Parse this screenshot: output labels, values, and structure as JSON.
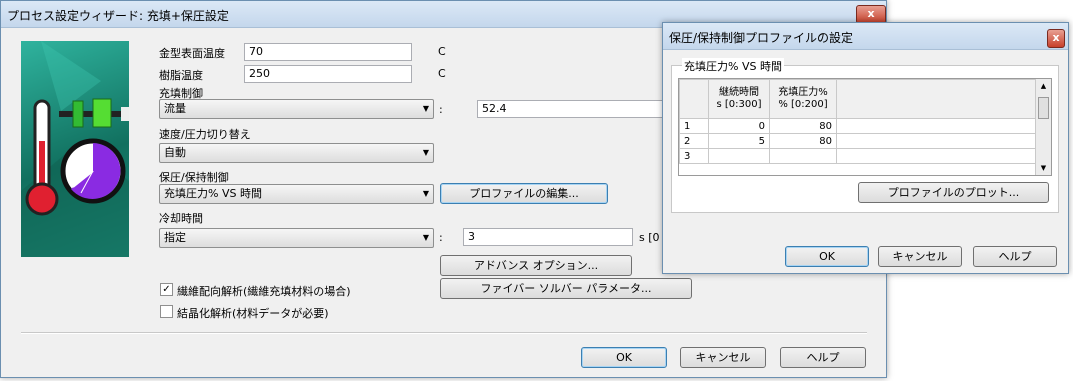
{
  "main_dialog": {
    "title": "プロセス設定ウィザード: 充填+保圧設定",
    "close_glyph": "x",
    "mold_temp": {
      "label": "金型表面温度",
      "value": "70",
      "unit": "C"
    },
    "melt_temp": {
      "label": "樹脂温度",
      "value": "250",
      "unit": "C"
    },
    "fill_control": {
      "label": "充填制御",
      "selected": "流量",
      "colon": ":",
      "value": "52.4"
    },
    "vp_switch": {
      "label": "速度/圧力切り替え",
      "selected": "自動"
    },
    "pack_control": {
      "label": "保圧/保持制御",
      "selected": "充填圧力% VS 時間",
      "edit_button": "プロファイルの編集..."
    },
    "cooling_time": {
      "label": "冷却時間",
      "selected": "指定",
      "colon": ":",
      "value": "3",
      "unit": "s [0"
    },
    "advanced_button": "アドバンス オプション...",
    "fiber_button": "ファイバー ソルバー パラメータ...",
    "fiber_check": {
      "label": "繊維配向解析(繊維充填材料の場合)",
      "checked": true
    },
    "crystal_check": {
      "label": "結晶化解析(材料データが必要)",
      "checked": false
    },
    "ok": "OK",
    "cancel": "キャンセル",
    "help": "ヘルプ"
  },
  "profile_dialog": {
    "title": "保圧/保持制御プロファイルの設定",
    "close_glyph": "x",
    "group_label": "充填圧力% VS 時間",
    "col1_line1": "継続時間",
    "col1_line2": "s [0:300]",
    "col2_line1": "充填圧力%",
    "col2_line2": "% [0:200]",
    "rows": [
      {
        "num": "1",
        "time": "0",
        "pressure": "80"
      },
      {
        "num": "2",
        "time": "5",
        "pressure": "80"
      },
      {
        "num": "3",
        "time": "",
        "pressure": ""
      }
    ],
    "plot_button": "プロファイルのプロット...",
    "ok": "OK",
    "cancel": "キャンセル",
    "help": "ヘルプ"
  },
  "icons": [
    "thermometer-icon",
    "clock-icon",
    "valve-icon",
    "combo-arrow-icon"
  ],
  "colors": {
    "title_bg": "#c4d7ec",
    "close_red": "#c7402b",
    "image_bg": "#1d9a86",
    "thermo_red": "#e02030",
    "clock_purple": "#8a2be2"
  }
}
